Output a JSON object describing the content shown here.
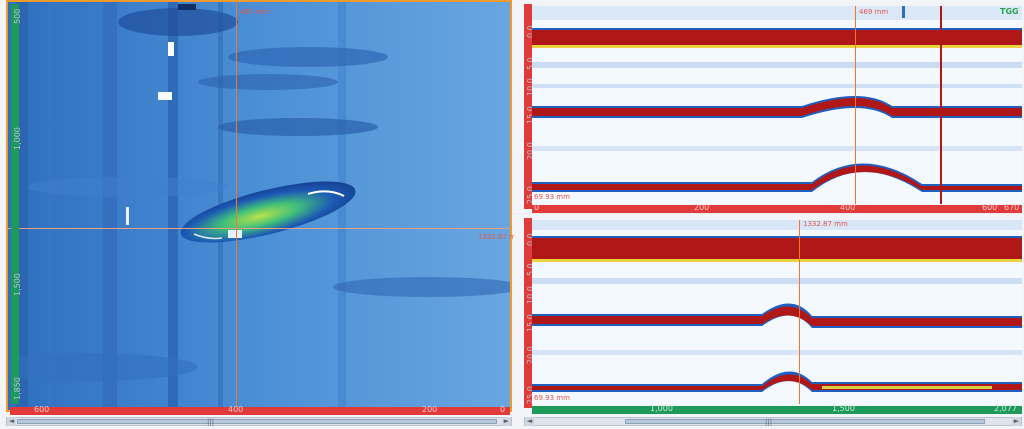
{
  "cscan": {
    "cursor_index_label": "465 mm",
    "cursor_position_label": "1332.87 mm",
    "vertical_ticks": [
      "500",
      "1,000",
      "1,500",
      "1,850"
    ],
    "horizontal_ticks": [
      "600",
      "400",
      "200",
      "0"
    ],
    "scroll_grip": "|||"
  },
  "bscan_top": {
    "cursor_label": "469 mm",
    "gate_label": "TGG",
    "bottom_value": "69.93 mm",
    "depth_ticks": [
      "0.0",
      "5.0",
      "10.0",
      "15.0",
      "20.0",
      "25.0"
    ],
    "horizontal_ticks": [
      "0",
      "200",
      "400",
      "600",
      "670"
    ]
  },
  "bscan_bottom": {
    "cursor_label": "1332.87 mm",
    "bottom_value": "69.93 mm",
    "depth_ticks": [
      "0.0",
      "5.0",
      "10.0",
      "15.0",
      "20.0",
      "25.0"
    ],
    "horizontal_ticks": [
      "1,000",
      "1,500",
      "2,077"
    ],
    "scroll_grip": "|||"
  },
  "colors": {
    "accent_orange": "#f29a2e",
    "axis_green": "#1d9a5a",
    "axis_red": "#e03a3a",
    "amplitude_high": "#b01818",
    "background_low": "#3d78c8"
  }
}
